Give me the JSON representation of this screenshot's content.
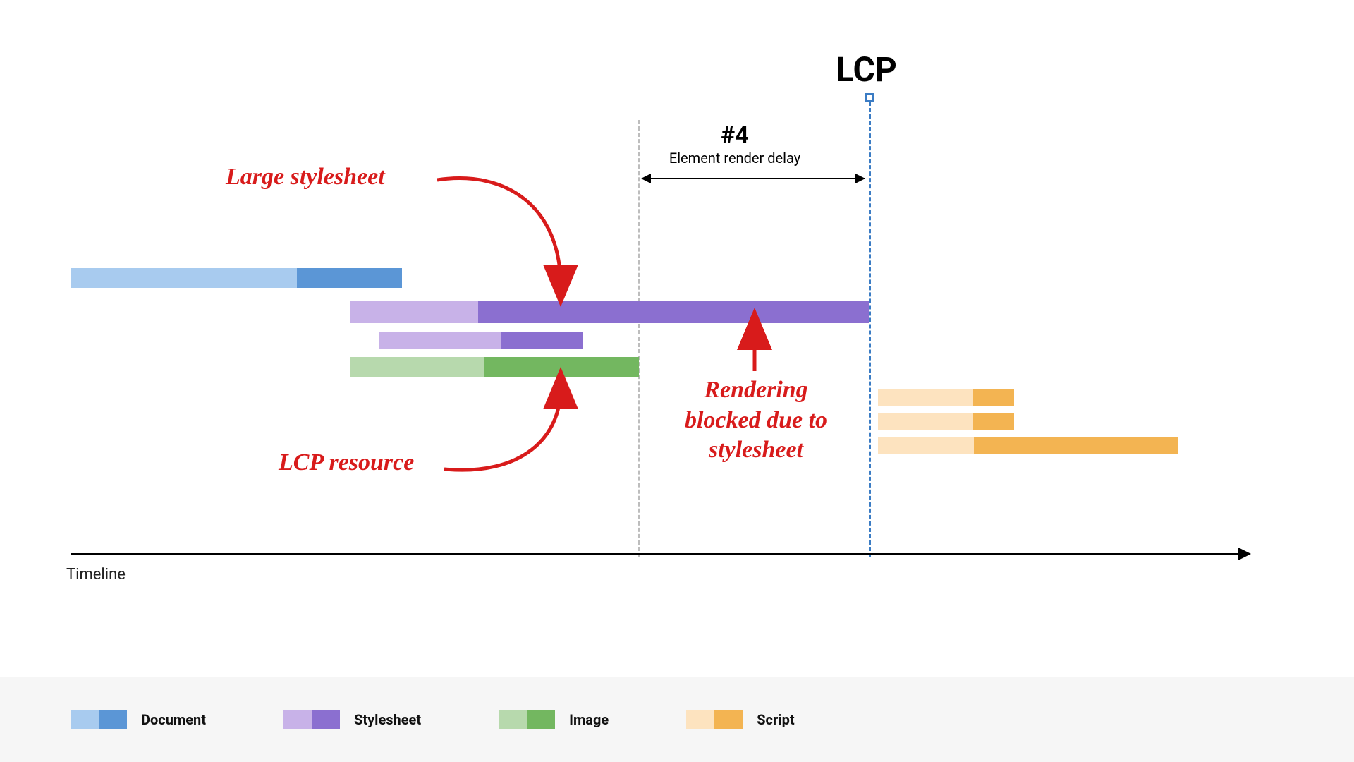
{
  "title": "LCP",
  "phase": {
    "num": "#4",
    "label": "Element render delay"
  },
  "annotations": {
    "large_stylesheet": "Large stylesheet",
    "lcp_resource": "LCP resource",
    "rendering_blocked": "Rendering\nblocked due to\nstylesheet"
  },
  "axis_label": "Timeline",
  "legend": [
    {
      "label": "Document",
      "light": "#a8cbef",
      "dark": "#5b96d6"
    },
    {
      "label": "Stylesheet",
      "light": "#c8b2e8",
      "dark": "#8b6fd0"
    },
    {
      "label": "Image",
      "light": "#b7d9ad",
      "dark": "#73b760"
    },
    {
      "label": "Script",
      "light": "#fde3bf",
      "dark": "#f3b452"
    }
  ],
  "chart_data": {
    "type": "gantt-waterfall",
    "x_unit": "relative timeline (0–100)",
    "markers": {
      "render_blocking_start": 48.8,
      "lcp": 68.5
    },
    "phase4_range": [
      48.8,
      68.5
    ],
    "bars": [
      {
        "name": "document",
        "category": "Document",
        "start": 0,
        "split": 19.5,
        "end": 28.5,
        "y": 0
      },
      {
        "name": "large-stylesheet",
        "category": "Stylesheet",
        "start": 24.0,
        "split": 35.0,
        "end": 68.5,
        "y": 1,
        "thick": true
      },
      {
        "name": "small-stylesheet",
        "category": "Stylesheet",
        "start": 26.5,
        "split": 37.0,
        "end": 44.0,
        "y": 2
      },
      {
        "name": "lcp-image",
        "category": "Image",
        "start": 24.0,
        "split": 35.5,
        "end": 48.8,
        "y": 3
      },
      {
        "name": "script-1",
        "category": "Script",
        "start": 69.3,
        "split": 77.5,
        "end": 81.0,
        "y": 4,
        "thin": true
      },
      {
        "name": "script-2",
        "category": "Script",
        "start": 69.3,
        "split": 77.5,
        "end": 81.0,
        "y": 5,
        "thin": true
      },
      {
        "name": "script-3",
        "category": "Script",
        "start": 69.3,
        "split": 77.5,
        "end": 95.0,
        "y": 6,
        "thin": true
      }
    ]
  }
}
